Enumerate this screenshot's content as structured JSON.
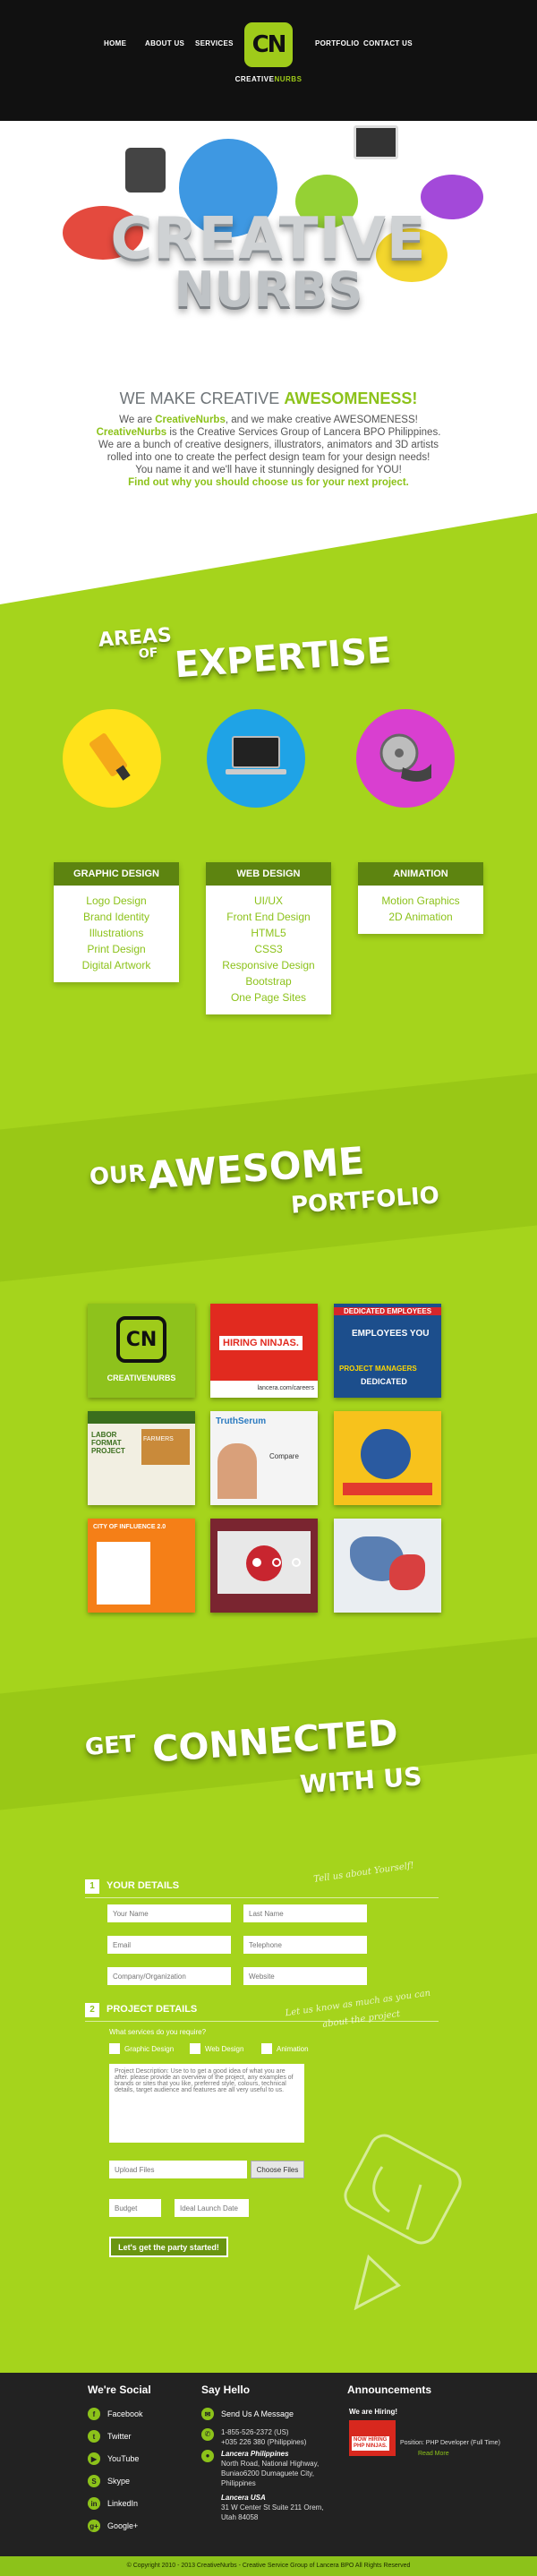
{
  "nav": {
    "items": [
      "HOME",
      "ABOUT US",
      "SERVICES",
      "PORTFOLIO",
      "CONTACT US"
    ],
    "logo_mark": "CN",
    "logo_text_1": "CREATIVE",
    "logo_text_2": "NURBS"
  },
  "hero": {
    "title_1": "CREATIVE",
    "title_2": "NURBS"
  },
  "intro": {
    "heading_1": "WE MAKE CREATIVE ",
    "heading_2": "AWESOMENESS!",
    "line_1a": "We are ",
    "line_1b": "CreativeNurbs",
    "line_1c": ", and we make creative AWESOMENESS!",
    "line_2a": "CreativeNurbs",
    "line_2b": " is the Creative Services Group of Lancera BPO Philippines.",
    "line_3": "We are a bunch of creative designers, illustrators, animators and 3D artists",
    "line_4": "rolled into one to create the perfect design team for your design needs!",
    "line_5": "You name it and we'll have it stunningly designed for YOU!",
    "cta": "Find out why you should choose us for your next project."
  },
  "expertise": {
    "title_1": "AREAS",
    "title_2": "OF",
    "title_3": "EXPERTISE",
    "cards": [
      {
        "heading_1": "GRAPHIC ",
        "heading_2": "DESIGN",
        "items": [
          "Logo Design",
          "Brand Identity",
          "Illustrations",
          "Print Design",
          "Digital Artwork"
        ]
      },
      {
        "heading_1": "WEB ",
        "heading_2": "DESIGN",
        "items": [
          "UI/UX",
          "Front End Design",
          "HTML5",
          "CSS3",
          "Responsive Design",
          "Bootstrap",
          "One Page Sites"
        ]
      },
      {
        "heading_1": "ANIMATION",
        "heading_2": "",
        "items": [
          "Motion Graphics",
          "2D Animation"
        ]
      }
    ],
    "colors": {
      "yellow": "#ffe21a",
      "blue": "#1fa3e6",
      "magenta": "#d93fd0"
    }
  },
  "portfolio": {
    "title_1": "OUR",
    "title_2": "AWESOME",
    "title_3": "PORTFOLIO",
    "thumbs": [
      {
        "label": "CREATIVENURBS",
        "mark": "CN"
      },
      {
        "label": "HIRING NINJAS.",
        "sub": "lancera.com/careers"
      },
      {
        "label": "DEDICATED EMPLOYEES",
        "sub": "EMPLOYEES YOU",
        "sub2": "PROJECT MANAGERS",
        "sub3": "DEDICATED"
      },
      {
        "label": "LABOR FORMAT PROJECT",
        "sub": "FARMERS"
      },
      {
        "label": "TruthSerum",
        "sub": "Compare"
      },
      {
        "label": ""
      },
      {
        "label": "CITY OF INFLUENCE 2.0"
      },
      {
        "label": ""
      },
      {
        "label": ""
      }
    ]
  },
  "contact": {
    "title_1": "GET",
    "title_2": "CONNECTED",
    "title_3": "WITH US",
    "step1_num": "1",
    "step1": "YOUR DETAILS",
    "step2_num": "2",
    "step2": "PROJECT DETAILS",
    "hand_1": "Tell us about Yourself!",
    "hand_2a": "Let us know as much as you can",
    "hand_2b": "about the project",
    "placeholders": {
      "first_name": "Your Name",
      "last_name": "Last Name",
      "email": "Email",
      "phone": "Telephone",
      "company": "Company/Organization",
      "website": "Website",
      "project_desc": "Project Description: Use to to get a good idea of what you are after. please provide an overview of the project, any examples of brands or sites that you like, preferred style, colours, technical details, target audience and features are all very useful to us.",
      "upload": "Upload Files",
      "budget": "Budget",
      "launch": "Ideal Launch Date"
    },
    "services_q": "What services do you require?",
    "services": [
      "Graphic Design",
      "Web Design",
      "Animation"
    ],
    "choose_files": "Choose Files",
    "submit": "Let's get the party started!"
  },
  "footer": {
    "social_title": "We're Social",
    "social": [
      "Facebook",
      "Twitter",
      "YouTube",
      "Skype",
      "LinkedIn",
      "Google+"
    ],
    "hello_title": "Say Hello",
    "send": "Send Us A Message",
    "phone_1": "1-855-526-2372 (US)",
    "phone_2": "+035 226 380 (Philippines)",
    "ph_name": "Lancera Philippines",
    "ph_addr_1": "North Road, National Highway,",
    "ph_addr_2": "Buniao6200 Dumaguete City,",
    "ph_addr_3": "Philippines",
    "us_name": "Lancera USA",
    "us_addr_1": "31 W Center St Suite 211 Orem,",
    "us_addr_2": "Utah 84058",
    "ann_title": "Announcements",
    "ann_hiring": "We are Hiring!",
    "ann_img_1": "NOW HIRING",
    "ann_img_2": "PHP NINJAS.",
    "ann_job": "Position: PHP Developer (Full Time)",
    "ann_more": "Read More",
    "copyright": "© Copyright 2010 - 2013 CreativeNurbs - Creative Service Group of Lancera BPO All Rights Reserved"
  }
}
